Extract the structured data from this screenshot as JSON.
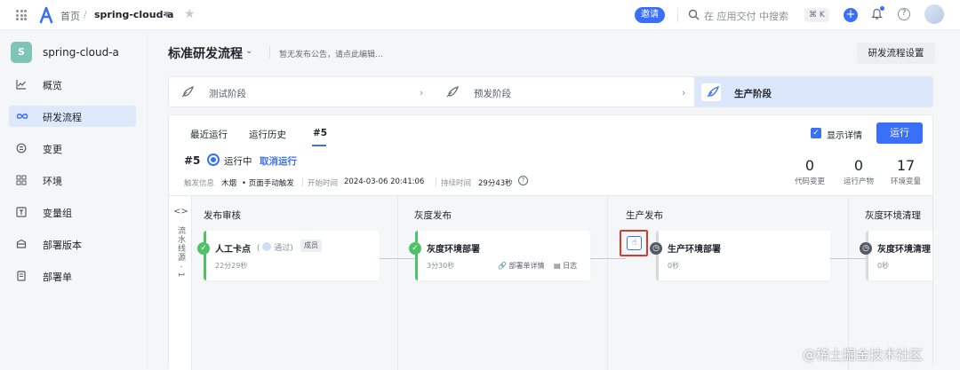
{
  "topbar": {
    "home": "首页",
    "separator": "/",
    "project": "spring-cloud-a",
    "invite": "邀请",
    "search_placeholder": "在 应用交付 中搜索",
    "shortcut": "⌘ K"
  },
  "sidebar": {
    "project_initial": "S",
    "project_name": "spring-cloud-a",
    "items": [
      {
        "label": "概览",
        "icon": "chart-line-icon"
      },
      {
        "label": "研发流程",
        "icon": "infinity-icon",
        "active": true
      },
      {
        "label": "变更",
        "icon": "change-icon"
      },
      {
        "label": "环境",
        "icon": "grid-icon"
      },
      {
        "label": "变量组",
        "icon": "variable-icon"
      },
      {
        "label": "部署版本",
        "icon": "package-icon"
      },
      {
        "label": "部署单",
        "icon": "document-icon"
      }
    ]
  },
  "main": {
    "title": "标准研发流程",
    "announcement": "暂无发布公告，请点此编辑...",
    "settings_button": "研发流程设置",
    "stages": [
      {
        "label": "测试阶段"
      },
      {
        "label": "预发阶段"
      },
      {
        "label": "生产阶段",
        "active": true
      }
    ]
  },
  "run": {
    "tabs": [
      "最近运行",
      "运行历史",
      "#5"
    ],
    "show_details": "显示详情",
    "run_button": "运行",
    "number": "#5",
    "status": "运行中",
    "cancel": "取消运行",
    "trigger_label": "触发信息",
    "trigger_user": "木烟",
    "trigger_type": "• 页面手动触发",
    "start_label": "开始时间",
    "start_time": "2024-03-06 20:41:06",
    "duration_label": "持续时间",
    "duration": "29分43秒",
    "stats": [
      {
        "value": "0",
        "label": "代码变更"
      },
      {
        "value": "0",
        "label": "运行产物"
      },
      {
        "value": "17",
        "label": "环境变量"
      }
    ]
  },
  "pipeline": {
    "collapse": "<>",
    "lane_label": "流水线源 · 1",
    "columns": [
      {
        "header": "发布审核",
        "job": {
          "name": "人工卡点",
          "passed": "通过)",
          "tag": "成员",
          "sub": "22分29秒",
          "status": "success"
        }
      },
      {
        "header": "灰度发布",
        "job": {
          "name": "灰度环境部署",
          "sub": "3分30秒",
          "action1": "部署单详情",
          "action2": "日志",
          "status": "success"
        }
      },
      {
        "header": "生产发布",
        "job": {
          "name": "生产环境部署",
          "sub": "0秒",
          "status": "waiting"
        }
      },
      {
        "header": "灰度环境清理",
        "job": {
          "name": "灰度环境清理",
          "sub": "0秒",
          "status": "waiting"
        }
      }
    ]
  },
  "watermark": "@稀土掘金技术社区",
  "colors": {
    "accent": "#3a6ff7",
    "success": "#52c26a",
    "highlight": "#d73a31"
  }
}
